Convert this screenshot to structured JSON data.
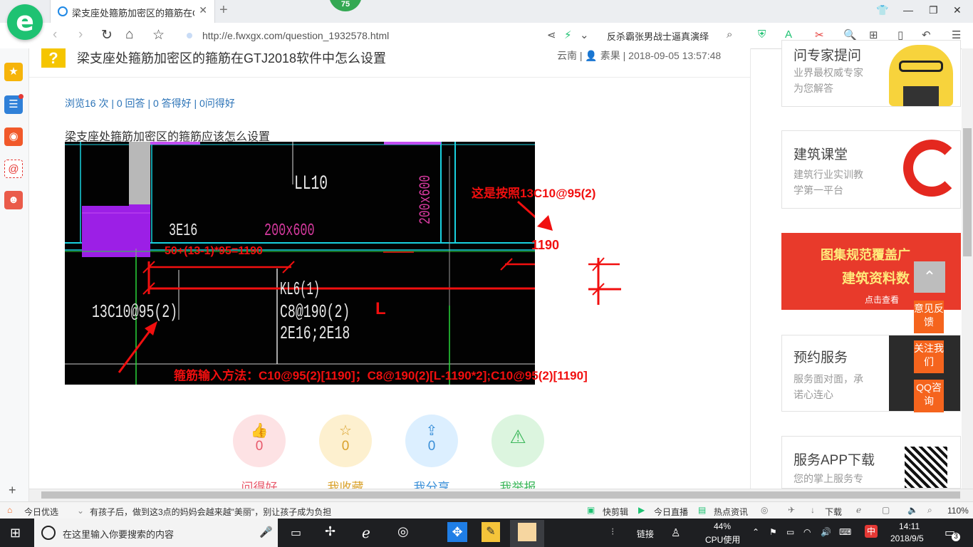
{
  "browser": {
    "tab_title": "梁支座处箍筋加密区的箍筋在GTJ",
    "badge_count": "75",
    "url": "http://e.fwxgx.com/question_1932578.html",
    "news_ticker": "反杀霸张男战士逼真演绎"
  },
  "question": {
    "title": "梁支座处箍筋加密区的箍筋在GTJ2018软件中怎么设置",
    "meta": "云南 | 👤 素果 | 2018-09-05 13:57:48",
    "stats": "浏览16 次 | 0 回答 | 0 答得好 | 0问得好",
    "body": "梁支座处箍筋加密区的箍筋应该怎么设置"
  },
  "cad": {
    "labels": {
      "ll10": "LL10",
      "size_v": "200x600",
      "rebar_3e16": "3E16",
      "size_h": "200x600",
      "stirrup": "13C10@95(2)",
      "kl": "KL6(1)",
      "c8": "C8@190(2)",
      "rebar_2e": "2E16;2E18"
    },
    "annotations": {
      "note": "这是按照13C10@95(2)",
      "formula": "50+(13-1)*95=1190",
      "length_1190": "1190",
      "span_L": "L",
      "method": "箍筋输入方法：C10@95(2)[1190]；C8@190(2)[L-1190*2];C10@95(2)[1190]"
    }
  },
  "actions": [
    {
      "label": "问得好",
      "count": "0",
      "icon": "thumbs-up-icon",
      "bg": "#fde2e4",
      "fg": "#e8596b"
    },
    {
      "label": "我收藏",
      "count": "0",
      "icon": "star-icon",
      "bg": "#fdf0cf",
      "fg": "#d9a12a"
    },
    {
      "label": "我分享",
      "count": "0",
      "icon": "share-icon",
      "bg": "#dcefff",
      "fg": "#3a8fd8"
    },
    {
      "label": "我举报",
      "count": "",
      "icon": "warning-icon",
      "bg": "#dcf5df",
      "fg": "#3bb75a"
    }
  ],
  "sidebar_cards": [
    {
      "title": "问专家提问",
      "sub1": "业界最权威专家",
      "sub2": "为您解答"
    },
    {
      "title": "建筑课堂",
      "sub1": "建筑行业实训教",
      "sub2": "学第一平台"
    },
    {
      "title": "图集规范覆盖广",
      "sub1": "建筑资料数",
      "sub2": "点击查看"
    },
    {
      "title": "预约服务",
      "sub1": "服务面对面，承",
      "sub2": "诺心连心"
    },
    {
      "title": "服务APP下载",
      "sub1": "您的掌上服务专",
      "sub2": ""
    }
  ],
  "float_buttons": [
    "意见反馈",
    "关注我们",
    "QQ咨询"
  ],
  "statusbar": {
    "left": "今日优选",
    "headline": "有孩子后，做到这3点的妈妈会越来越\"美丽\"，别让孩子成为负担",
    "items": [
      "快剪辑",
      "今日直播",
      "热点资讯",
      "下载"
    ],
    "zoom": "110%"
  },
  "taskbar": {
    "search_placeholder": "在这里输入你要搜索的内容",
    "link": "链接",
    "cpu_percent": "44%",
    "cpu_label": "CPU使用",
    "ime": "中",
    "time": "14:11",
    "date": "2018/9/5",
    "notif": "3"
  },
  "colors": {
    "brand_green": "#1ec272",
    "accent_orange": "#f5641d",
    "link_blue": "#2b73b7",
    "annotation_red": "#f10f0f"
  }
}
